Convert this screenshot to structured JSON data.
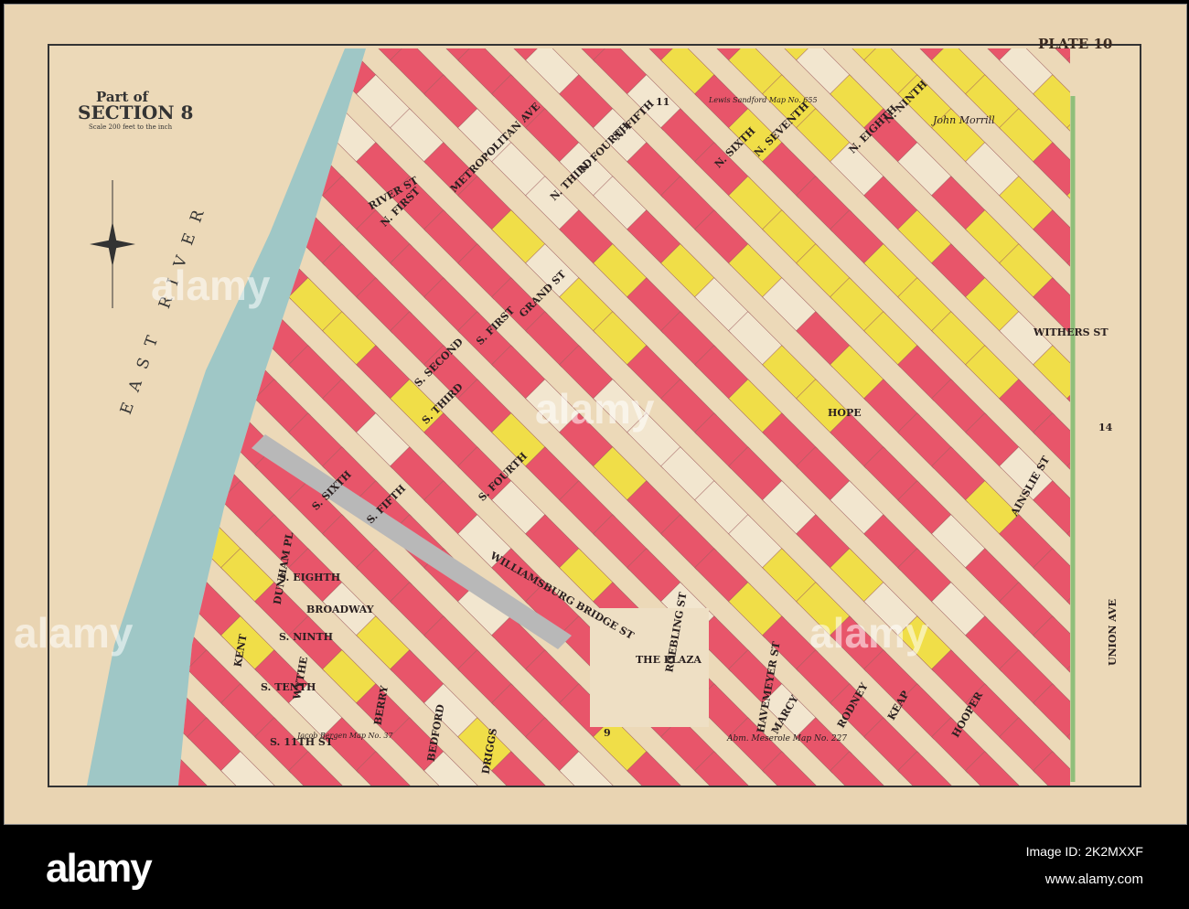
{
  "plate": "PLATE 10",
  "title": {
    "line1": "Part of",
    "line2": "SECTION 8",
    "scale": "Scale 200 feet to the inch"
  },
  "river": "EAST RIVER",
  "section_numbers": [
    "11",
    "14",
    "9"
  ],
  "streets": [
    "METROPOLITAN AVE",
    "N. FIRST",
    "N. THIRD",
    "N. FOURTH",
    "N. FIFTH",
    "N. SIXTH",
    "N. SEVENTH",
    "N. EIGHTH",
    "N. NINTH",
    "GRAND ST",
    "S. FIRST",
    "S. SECOND",
    "S. THIRD",
    "S. FOURTH",
    "S. FIFTH",
    "S. SIXTH",
    "S. EIGHTH",
    "S. NINTH",
    "S. TENTH",
    "S. 11TH ST",
    "BROADWAY",
    "WILLIAMSBURG BRIDGE ST",
    "THE PLAZA",
    "ROEBLING ST",
    "HAVEMEYER ST",
    "MARCY",
    "RODNEY",
    "KEAP",
    "HOOPER",
    "HOPE",
    "AINSLIE ST",
    "UNION AVE",
    "WITHERS ST",
    "KENT",
    "WYTHE",
    "BERRY",
    "BEDFORD",
    "DRIGGS",
    "RIVER ST",
    "DUNHAM PL"
  ],
  "owners": [
    "John Morrill",
    "Jacob Bergen Map No. 37",
    "Abm. Meserole Map No. 227",
    "Lewis Sandford Map No. 655"
  ],
  "watermark": "alamy",
  "footer": {
    "logo": "alamy",
    "image_id": "Image ID: 2K2MXXF",
    "url": "www.alamy.com"
  },
  "colors": {
    "brick": "#e8556a",
    "frame": "#f0de48",
    "water": "#9fc7c6",
    "paper": "#ecd9b8"
  }
}
